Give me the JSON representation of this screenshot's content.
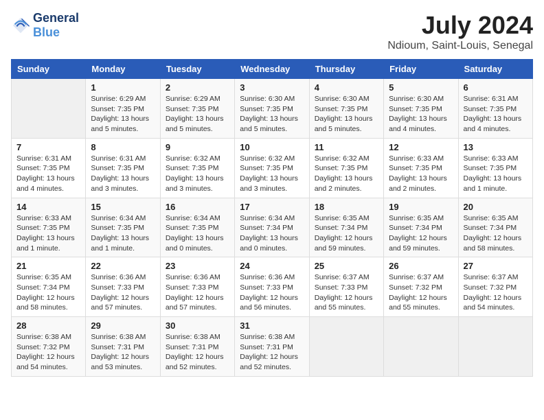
{
  "logo": {
    "line1": "General",
    "line2": "Blue"
  },
  "title": "July 2024",
  "subtitle": "Ndioum, Saint-Louis, Senegal",
  "weekdays": [
    "Sunday",
    "Monday",
    "Tuesday",
    "Wednesday",
    "Thursday",
    "Friday",
    "Saturday"
  ],
  "weeks": [
    [
      {
        "day": "",
        "info": ""
      },
      {
        "day": "1",
        "info": "Sunrise: 6:29 AM\nSunset: 7:35 PM\nDaylight: 13 hours\nand 5 minutes."
      },
      {
        "day": "2",
        "info": "Sunrise: 6:29 AM\nSunset: 7:35 PM\nDaylight: 13 hours\nand 5 minutes."
      },
      {
        "day": "3",
        "info": "Sunrise: 6:30 AM\nSunset: 7:35 PM\nDaylight: 13 hours\nand 5 minutes."
      },
      {
        "day": "4",
        "info": "Sunrise: 6:30 AM\nSunset: 7:35 PM\nDaylight: 13 hours\nand 5 minutes."
      },
      {
        "day": "5",
        "info": "Sunrise: 6:30 AM\nSunset: 7:35 PM\nDaylight: 13 hours\nand 4 minutes."
      },
      {
        "day": "6",
        "info": "Sunrise: 6:31 AM\nSunset: 7:35 PM\nDaylight: 13 hours\nand 4 minutes."
      }
    ],
    [
      {
        "day": "7",
        "info": "Sunrise: 6:31 AM\nSunset: 7:35 PM\nDaylight: 13 hours\nand 4 minutes."
      },
      {
        "day": "8",
        "info": "Sunrise: 6:31 AM\nSunset: 7:35 PM\nDaylight: 13 hours\nand 3 minutes."
      },
      {
        "day": "9",
        "info": "Sunrise: 6:32 AM\nSunset: 7:35 PM\nDaylight: 13 hours\nand 3 minutes."
      },
      {
        "day": "10",
        "info": "Sunrise: 6:32 AM\nSunset: 7:35 PM\nDaylight: 13 hours\nand 3 minutes."
      },
      {
        "day": "11",
        "info": "Sunrise: 6:32 AM\nSunset: 7:35 PM\nDaylight: 13 hours\nand 2 minutes."
      },
      {
        "day": "12",
        "info": "Sunrise: 6:33 AM\nSunset: 7:35 PM\nDaylight: 13 hours\nand 2 minutes."
      },
      {
        "day": "13",
        "info": "Sunrise: 6:33 AM\nSunset: 7:35 PM\nDaylight: 13 hours\nand 1 minute."
      }
    ],
    [
      {
        "day": "14",
        "info": "Sunrise: 6:33 AM\nSunset: 7:35 PM\nDaylight: 13 hours\nand 1 minute."
      },
      {
        "day": "15",
        "info": "Sunrise: 6:34 AM\nSunset: 7:35 PM\nDaylight: 13 hours\nand 1 minute."
      },
      {
        "day": "16",
        "info": "Sunrise: 6:34 AM\nSunset: 7:35 PM\nDaylight: 13 hours\nand 0 minutes."
      },
      {
        "day": "17",
        "info": "Sunrise: 6:34 AM\nSunset: 7:34 PM\nDaylight: 13 hours\nand 0 minutes."
      },
      {
        "day": "18",
        "info": "Sunrise: 6:35 AM\nSunset: 7:34 PM\nDaylight: 12 hours\nand 59 minutes."
      },
      {
        "day": "19",
        "info": "Sunrise: 6:35 AM\nSunset: 7:34 PM\nDaylight: 12 hours\nand 59 minutes."
      },
      {
        "day": "20",
        "info": "Sunrise: 6:35 AM\nSunset: 7:34 PM\nDaylight: 12 hours\nand 58 minutes."
      }
    ],
    [
      {
        "day": "21",
        "info": "Sunrise: 6:35 AM\nSunset: 7:34 PM\nDaylight: 12 hours\nand 58 minutes."
      },
      {
        "day": "22",
        "info": "Sunrise: 6:36 AM\nSunset: 7:33 PM\nDaylight: 12 hours\nand 57 minutes."
      },
      {
        "day": "23",
        "info": "Sunrise: 6:36 AM\nSunset: 7:33 PM\nDaylight: 12 hours\nand 57 minutes."
      },
      {
        "day": "24",
        "info": "Sunrise: 6:36 AM\nSunset: 7:33 PM\nDaylight: 12 hours\nand 56 minutes."
      },
      {
        "day": "25",
        "info": "Sunrise: 6:37 AM\nSunset: 7:33 PM\nDaylight: 12 hours\nand 55 minutes."
      },
      {
        "day": "26",
        "info": "Sunrise: 6:37 AM\nSunset: 7:32 PM\nDaylight: 12 hours\nand 55 minutes."
      },
      {
        "day": "27",
        "info": "Sunrise: 6:37 AM\nSunset: 7:32 PM\nDaylight: 12 hours\nand 54 minutes."
      }
    ],
    [
      {
        "day": "28",
        "info": "Sunrise: 6:38 AM\nSunset: 7:32 PM\nDaylight: 12 hours\nand 54 minutes."
      },
      {
        "day": "29",
        "info": "Sunrise: 6:38 AM\nSunset: 7:31 PM\nDaylight: 12 hours\nand 53 minutes."
      },
      {
        "day": "30",
        "info": "Sunrise: 6:38 AM\nSunset: 7:31 PM\nDaylight: 12 hours\nand 52 minutes."
      },
      {
        "day": "31",
        "info": "Sunrise: 6:38 AM\nSunset: 7:31 PM\nDaylight: 12 hours\nand 52 minutes."
      },
      {
        "day": "",
        "info": ""
      },
      {
        "day": "",
        "info": ""
      },
      {
        "day": "",
        "info": ""
      }
    ]
  ]
}
